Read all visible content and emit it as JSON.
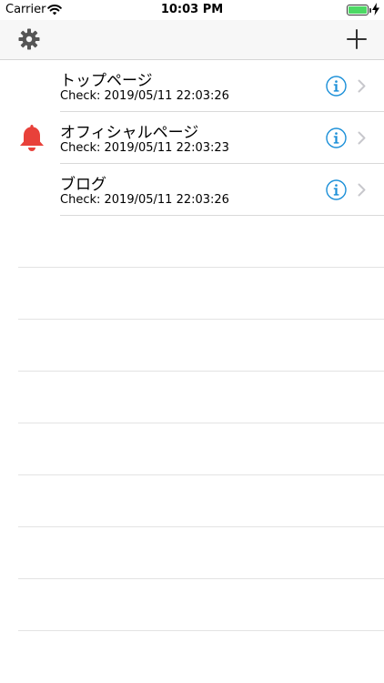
{
  "status_bar": {
    "carrier": "Carrier",
    "time": "10:03 PM",
    "battery_level": 0.9
  },
  "nav": {
    "left_icon": "gear-icon",
    "right_icon": "plus-icon"
  },
  "colors": {
    "accent": "#1a8fd8",
    "bell": "#e8413a",
    "battery": "#4cd964"
  },
  "rows": [
    {
      "title": "トップページ",
      "subtitle": "Check: 2019/05/11 22:03:26",
      "has_alert": false
    },
    {
      "title": "オフィシャルページ",
      "subtitle": "Check: 2019/05/11 22:03:23",
      "has_alert": true
    },
    {
      "title": "ブログ",
      "subtitle": "Check: 2019/05/11 22:03:26",
      "has_alert": false
    }
  ]
}
